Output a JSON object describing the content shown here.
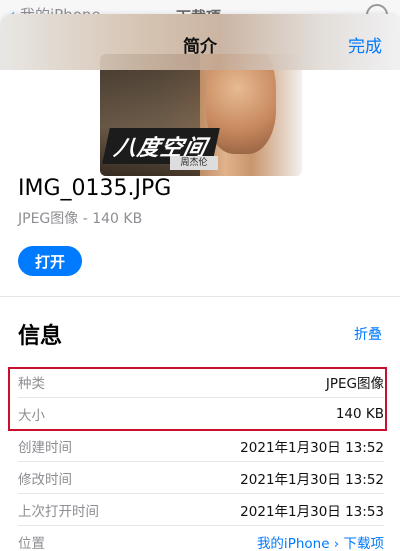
{
  "behind": {
    "back_label": "我的iPhone",
    "title": "下载项"
  },
  "sheet": {
    "title": "简介",
    "done_label": "完成"
  },
  "thumbnail": {
    "art_text": "八度空间",
    "art_subtext": "周杰伦"
  },
  "file": {
    "name": "IMG_0135.JPG",
    "subtitle": "JPEG图像 - 140 KB",
    "open_label": "打开"
  },
  "info": {
    "title": "信息",
    "collapse_label": "折叠",
    "rows": [
      {
        "key": "种类",
        "value": "JPEG图像"
      },
      {
        "key": "大小",
        "value": "140 KB"
      },
      {
        "key": "创建时间",
        "value": "2021年1月30日 13:52"
      },
      {
        "key": "修改时间",
        "value": "2021年1月30日 13:52"
      },
      {
        "key": "上次打开时间",
        "value": "2021年1月30日 13:53"
      },
      {
        "key": "位置",
        "value": "我的iPhone › 下载项"
      }
    ]
  },
  "colors": {
    "accent": "#007aff",
    "highlight": "#c8102e"
  }
}
